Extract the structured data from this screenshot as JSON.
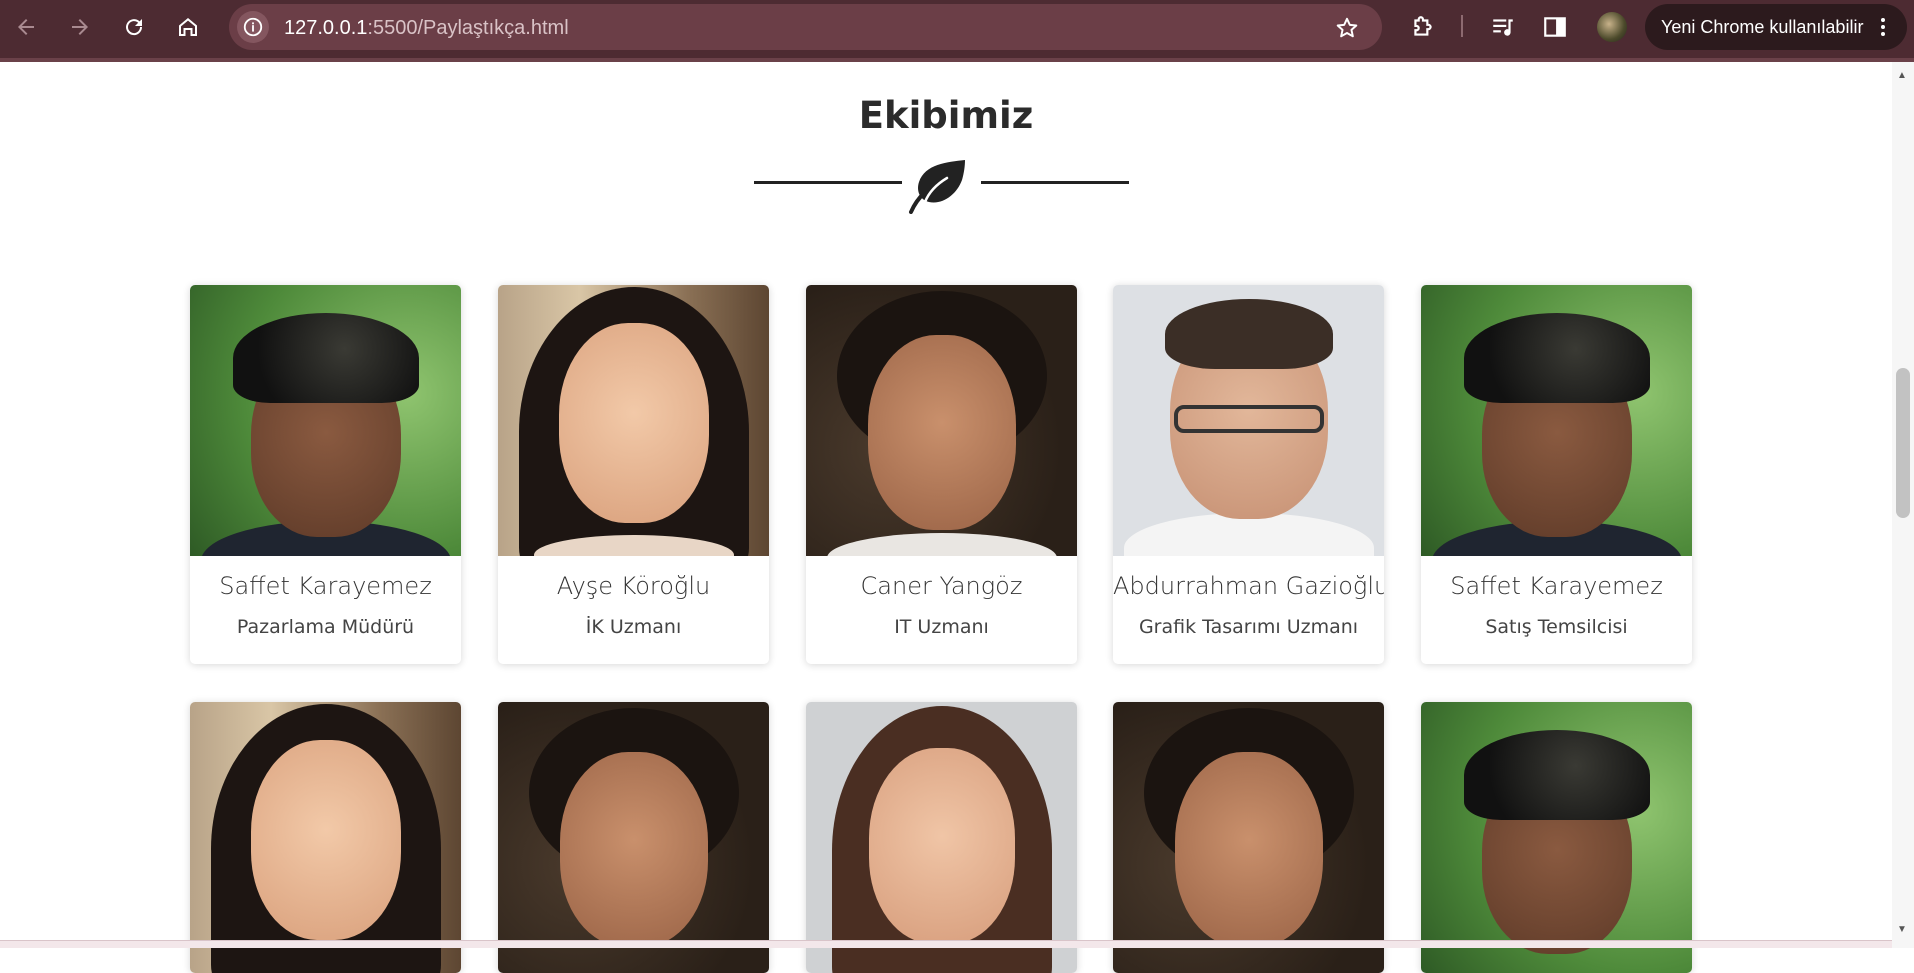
{
  "browser": {
    "url_host": "127.0.0.1",
    "url_path": ":5500/Paylaştıkça.html",
    "chip_label": "Yeni Chrome kullanılabilir"
  },
  "section": {
    "title": "Ekibimiz"
  },
  "team_row1": [
    {
      "name": "Saffet Karayemez",
      "role": "Pazarlama Müdürü",
      "photo": "bandana-man"
    },
    {
      "name": "Ayşe Köroğlu",
      "role": "İK Uzmanı",
      "photo": "smiling-woman"
    },
    {
      "name": "Caner Yangöz",
      "role": "IT Uzmanı",
      "photo": "curly-man"
    },
    {
      "name": "Abdurrahman Gazioğlu",
      "role": "Grafik Tasarımı Uzmanı",
      "photo": "glasses-man"
    },
    {
      "name": "Saffet Karayemez",
      "role": "Satış Temsilcisi",
      "photo": "bandana-man"
    }
  ],
  "team_row2": [
    {
      "photo": "smiling-woman"
    },
    {
      "photo": "curly-man"
    },
    {
      "photo": "woman-brown-hair"
    },
    {
      "photo": "curly-man"
    },
    {
      "photo": "bandana-man"
    }
  ],
  "colors": {
    "chrome_bg": "#4d2b32",
    "omnibox_bg": "#6b3e47",
    "accent_dark": "#222222"
  }
}
